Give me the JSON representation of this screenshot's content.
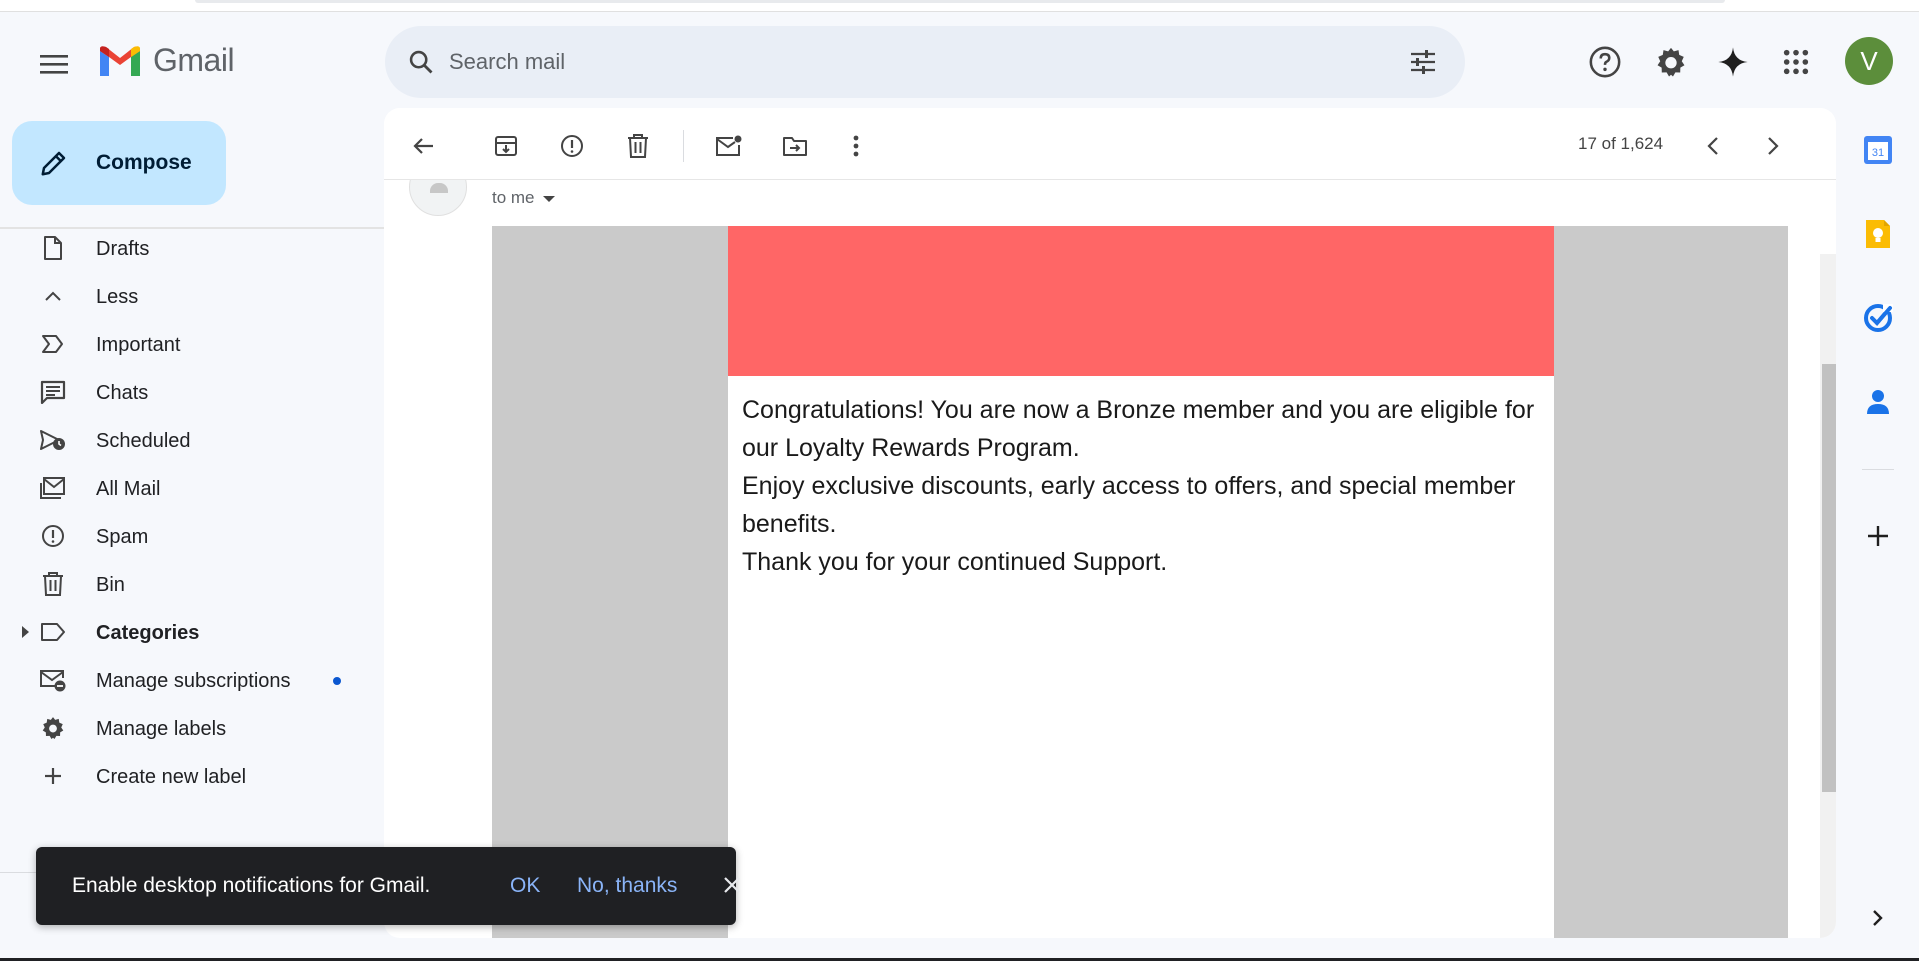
{
  "app": {
    "name": "Gmail"
  },
  "search": {
    "placeholder": "Search mail"
  },
  "header": {
    "avatar_letter": "V"
  },
  "compose": {
    "label": "Compose"
  },
  "sidebar": {
    "items": [
      {
        "label": "Drafts",
        "icon": "draft-icon"
      },
      {
        "label": "Less",
        "icon": "chevron-up-icon"
      },
      {
        "label": "Important",
        "icon": "important-icon"
      },
      {
        "label": "Chats",
        "icon": "chat-icon"
      },
      {
        "label": "Scheduled",
        "icon": "scheduled-icon"
      },
      {
        "label": "All Mail",
        "icon": "all-mail-icon"
      },
      {
        "label": "Spam",
        "icon": "spam-icon"
      },
      {
        "label": "Bin",
        "icon": "bin-icon"
      },
      {
        "label": "Categories",
        "icon": "label-icon"
      },
      {
        "label": "Manage subscriptions",
        "icon": "manage-subscriptions-icon"
      },
      {
        "label": "Manage labels",
        "icon": "gear-icon"
      },
      {
        "label": "Create new label",
        "icon": "plus-icon"
      }
    ]
  },
  "toolbar": {
    "pager": "17 of 1,624"
  },
  "message": {
    "recipient": "to me",
    "body": [
      "Congratulations! You are now a Bronze member and you are eligible for our Loyalty Rewards Program.",
      "Enjoy exclusive discounts, early access to offers, and special member benefits.",
      "Thank you for your continued Support."
    ],
    "banner_color": "#ff6666"
  },
  "snackbar": {
    "message": "Enable desktop notifications for Gmail.",
    "ok": "OK",
    "no": "No, thanks"
  },
  "rail": {
    "calendar_day": "31"
  },
  "colors": {
    "compose_bg": "#c2e7ff",
    "avatar_bg": "#5c8e3b",
    "link": "#8ab4f8"
  }
}
